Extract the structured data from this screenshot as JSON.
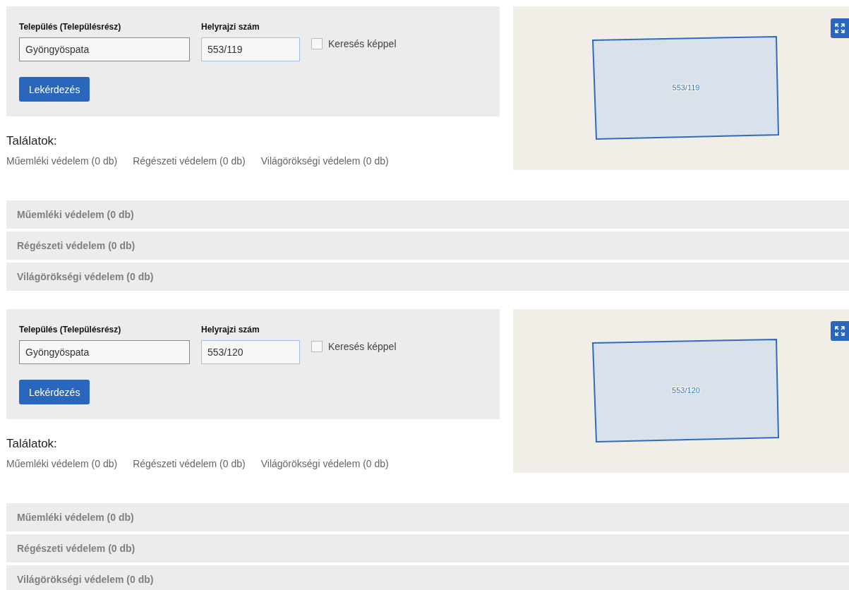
{
  "sections": [
    {
      "form": {
        "settlement_label": "Település (Településrész)",
        "settlement_value": "Gyöngyöspata",
        "lot_label": "Helyrajzi szám",
        "lot_value": "553/119",
        "image_search": {
          "label": "Keresés képpel",
          "checked": false
        },
        "submit": "Lekérdezés"
      },
      "map": {
        "parcel_label": "553/119"
      },
      "results": {
        "heading": "Találatok:",
        "summary": [
          "Műemléki védelem (0 db)",
          "Régészeti védelem (0 db)",
          "Világörökségi védelem (0 db)"
        ],
        "panels": [
          {
            "title": "Műemléki védelem (0 db)",
            "expanded": false
          },
          {
            "title": "Régészeti védelem (0 db)",
            "expanded": false
          },
          {
            "title": "Világörökségi védelem (0 db)",
            "expanded": false
          }
        ]
      }
    },
    {
      "form": {
        "settlement_label": "Település (Településrész)",
        "settlement_value": "Gyöngyöspata",
        "lot_label": "Helyrajzi szám",
        "lot_value": "553/120",
        "image_search": {
          "label": "Keresés képpel",
          "checked": false
        },
        "submit": "Lekérdezés"
      },
      "map": {
        "parcel_label": "553/120"
      },
      "results": {
        "heading": "Találatok:",
        "summary": [
          "Műemléki védelem (0 db)",
          "Régészeti védelem (0 db)",
          "Világörökségi védelem (0 db)"
        ],
        "panels": [
          {
            "title": "Műemléki védelem (0 db)",
            "expanded": false
          },
          {
            "title": "Régészeti védelem (0 db)",
            "expanded": false
          },
          {
            "title": "Világörökségi védelem (0 db)",
            "expanded": false
          }
        ]
      }
    }
  ]
}
